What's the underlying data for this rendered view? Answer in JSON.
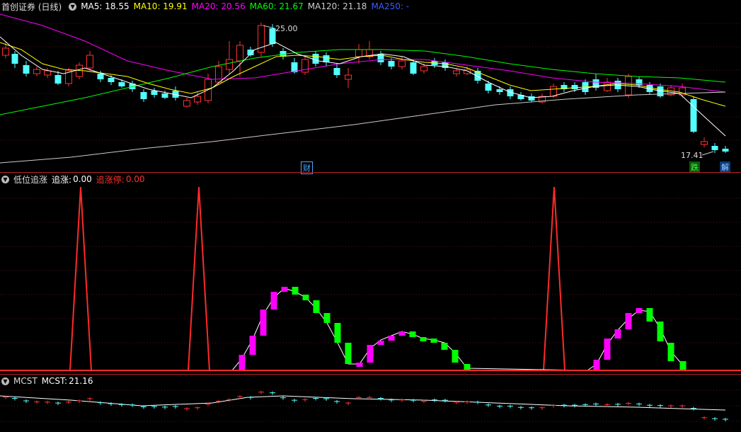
{
  "main": {
    "title": "首创证券 (日线)",
    "indicators": [
      {
        "label": "MA5:",
        "value": "18.55",
        "color": "#ffffff"
      },
      {
        "label": "MA10:",
        "value": "19.91",
        "color": "#ffff00"
      },
      {
        "label": "MA20:",
        "value": "20.56",
        "color": "#ff00ff"
      },
      {
        "label": "MA60:",
        "value": "21.67",
        "color": "#00ff00"
      },
      {
        "label": "MA120:",
        "value": "21.18",
        "color": "#cccccc"
      },
      {
        "label": "MA250:",
        "value": "-",
        "color": "#3b5bff"
      }
    ],
    "high_label": "25.00",
    "low_label": "17.41",
    "badges": [
      {
        "text": "财",
        "color": "#4aa8ff"
      },
      {
        "text": "跌",
        "color": "#1fd11f"
      },
      {
        "text": "解",
        "color": "#4aa8ff"
      }
    ]
  },
  "indicator_panel": {
    "title": "低位追涨",
    "label1": "追涨:",
    "value1": "0.00",
    "label2": "追涨停:",
    "value2": "0.00"
  },
  "mcst_panel": {
    "title": "MCST",
    "label": "MCST:",
    "value": "21.16"
  },
  "colors": {
    "up": "#ff3030",
    "down": "#54ffff",
    "ma5": "#ffffff",
    "ma10": "#ffff00",
    "ma20": "#ff00ff",
    "ma60": "#00ff00",
    "ma120": "#cccccc",
    "rise": "#ff00ff",
    "fall": "#00ff00"
  }
}
